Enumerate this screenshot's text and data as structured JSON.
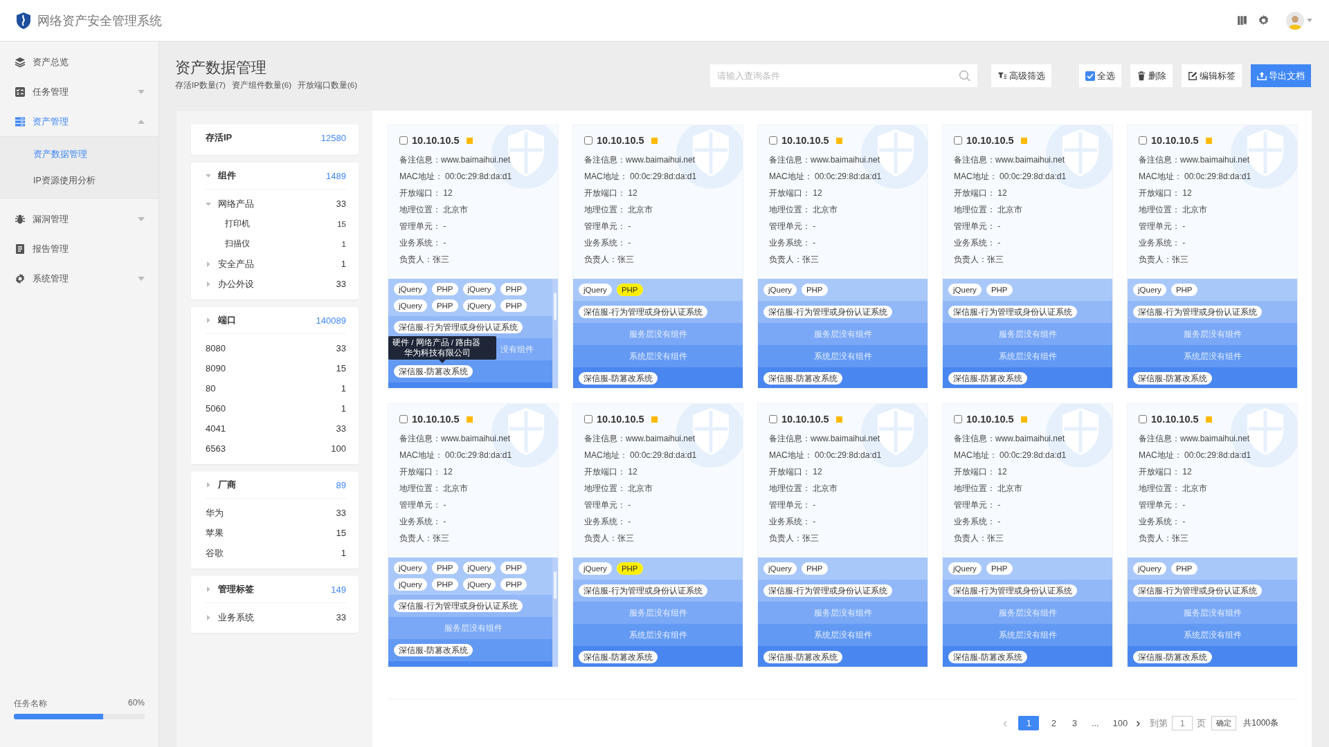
{
  "app": {
    "title": "网络资产安全管理系统"
  },
  "sidebar": {
    "items": [
      {
        "label": "资产总览",
        "selected": false
      },
      {
        "label": "任务管理",
        "selected": false,
        "expanded": false
      },
      {
        "label": "资产管理",
        "selected": true,
        "expanded": true,
        "children": [
          {
            "label": "资产数据管理",
            "selected": true
          },
          {
            "label": "IP资源使用分析",
            "selected": false
          }
        ]
      },
      {
        "label": "漏洞管理",
        "selected": false,
        "expanded": false
      },
      {
        "label": "报告管理",
        "selected": false
      },
      {
        "label": "系统管理",
        "selected": false,
        "expanded": false
      }
    ],
    "task": {
      "label": "任务名称",
      "reading": "60%",
      "level": 0.68
    }
  },
  "header": {
    "title": "资产数据管理",
    "stats": [
      "存活IP数量(7)",
      "资产组件数量(6)",
      "开放端口数量(6)"
    ]
  },
  "toolbar": {
    "search": {
      "placeholder": "请输入查询条件"
    },
    "buttons": [
      {
        "kind": "filter",
        "label": "高级筛选"
      },
      {
        "kind": "select_all",
        "label": "全选",
        "checked": true
      },
      {
        "kind": "delete",
        "label": "删除"
      },
      {
        "kind": "edit",
        "label": "编辑标签"
      },
      {
        "kind": "export",
        "label": "导出文档"
      }
    ]
  },
  "filters": [
    {
      "label": "存活IP",
      "count": "12580"
    },
    {
      "label": "组件",
      "count": "1489",
      "expanded": true,
      "children": [
        {
          "label": "网络产品",
          "count": "33",
          "expanded": true,
          "children": [
            {
              "label": "打印机",
              "count": "15"
            },
            {
              "label": "扫描仪",
              "count": "1"
            }
          ]
        },
        {
          "label": "安全产品",
          "count": "1",
          "expanded": false
        },
        {
          "label": "办公外设",
          "count": "33",
          "expanded": false
        }
      ]
    },
    {
      "label": "端口",
      "count": "140089",
      "expanded": false,
      "items": [
        {
          "label": "8080",
          "count": "33"
        },
        {
          "label": "8090",
          "count": "15"
        },
        {
          "label": "80",
          "count": "1"
        },
        {
          "label": "5060",
          "count": "1"
        },
        {
          "label": "4041",
          "count": "33"
        },
        {
          "label": "6563",
          "count": "100"
        }
      ]
    },
    {
      "label": "厂商",
      "count": "89",
      "expanded": false,
      "items": [
        {
          "label": "华为",
          "count": "33"
        },
        {
          "label": "苹果",
          "count": "15"
        },
        {
          "label": "谷歌",
          "count": "1"
        }
      ]
    },
    {
      "label": "管理标签",
      "count": "149",
      "expanded": false,
      "children": [
        {
          "label": "业务系统",
          "count": "33",
          "expanded": false
        }
      ]
    }
  ],
  "cards": [
    {
      "ip": "10.10.10.5",
      "checked": false,
      "color": "#ffb900",
      "info": [
        "备注信息：www.baimaihui.net",
        "MAC地址： 00:0c:29:8d:da:d1",
        "开放端口： 12",
        "地理位置： 北京市",
        "管理单元： -",
        "业务系统： -",
        "负责人：张三"
      ],
      "scrollable": true,
      "bands": [
        {
          "kind": "tags",
          "tags": [
            {
              "text": "jQuery",
              "highlighted": false
            },
            {
              "text": "PHP",
              "highlighted": false
            },
            {
              "text": "jQuery",
              "highlighted": false
            },
            {
              "text": "PHP",
              "highlighted": false
            },
            {
              "text": "jQuery",
              "highlighted": false
            },
            {
              "text": "PHP",
              "highlighted": false
            },
            {
              "text": "jQuery",
              "highlighted": false
            },
            {
              "text": "PHP",
              "highlighted": false
            }
          ]
        },
        {
          "kind": "tag",
          "text": "深信服-行为管理或身份认证系统"
        },
        {
          "kind": "note",
          "text": "没有组件",
          "tooltip": {
            "lines": [
              "硬件 / 网络产品 / 路由器",
              "华为科技有限公司"
            ]
          }
        },
        {
          "kind": "tag",
          "text": "深信服-防篡改系统"
        }
      ]
    },
    {
      "ip": "10.10.10.5",
      "checked": false,
      "color": "#ffb900",
      "info": [
        "备注信息：www.baimaihui.net",
        "MAC地址： 00:0c:29:8d:da:d1",
        "开放端口： 12",
        "地理位置： 北京市",
        "管理单元： -",
        "业务系统： -",
        "负责人：张三"
      ],
      "scrollable": false,
      "bands": [
        {
          "kind": "tags",
          "tags": [
            {
              "text": "jQuery",
              "highlighted": false
            },
            {
              "text": "PHP",
              "highlighted": true
            }
          ]
        },
        {
          "kind": "tag",
          "text": "深信服-行为管理或身份认证系统"
        },
        {
          "kind": "note",
          "text": "服务层没有组件"
        },
        {
          "kind": "note",
          "text": "系统层没有组件"
        },
        {
          "kind": "tag",
          "text": "深信服-防篡改系统"
        }
      ]
    },
    {
      "ip": "10.10.10.5",
      "checked": false,
      "color": "#ffb900",
      "info": [
        "备注信息：www.baimaihui.net",
        "MAC地址： 00:0c:29:8d:da:d1",
        "开放端口： 12",
        "地理位置： 北京市",
        "管理单元： -",
        "业务系统： -",
        "负责人：张三"
      ],
      "scrollable": false,
      "bands": [
        {
          "kind": "tags",
          "tags": [
            {
              "text": "jQuery",
              "highlighted": false
            },
            {
              "text": "PHP",
              "highlighted": false
            }
          ]
        },
        {
          "kind": "tag",
          "text": "深信服-行为管理或身份认证系统"
        },
        {
          "kind": "note",
          "text": "服务层没有组件"
        },
        {
          "kind": "note",
          "text": "系统层没有组件"
        },
        {
          "kind": "tag",
          "text": "深信服-防篡改系统"
        }
      ]
    },
    {
      "ip": "10.10.10.5",
      "checked": false,
      "color": "#ffb900",
      "info": [
        "备注信息：www.baimaihui.net",
        "MAC地址： 00:0c:29:8d:da:d1",
        "开放端口： 12",
        "地理位置： 北京市",
        "管理单元： -",
        "业务系统： -",
        "负责人：张三"
      ],
      "scrollable": false,
      "bands": [
        {
          "kind": "tags",
          "tags": [
            {
              "text": "jQuery",
              "highlighted": false
            },
            {
              "text": "PHP",
              "highlighted": false
            }
          ]
        },
        {
          "kind": "tag",
          "text": "深信服-行为管理或身份认证系统"
        },
        {
          "kind": "note",
          "text": "服务层没有组件"
        },
        {
          "kind": "note",
          "text": "系统层没有组件"
        },
        {
          "kind": "tag",
          "text": "深信服-防篡改系统"
        }
      ]
    },
    {
      "ip": "10.10.10.5",
      "checked": false,
      "color": "#ffb900",
      "info": [
        "备注信息：www.baimaihui.net",
        "MAC地址： 00:0c:29:8d:da:d1",
        "开放端口： 12",
        "地理位置： 北京市",
        "管理单元： -",
        "业务系统： -",
        "负责人：张三"
      ],
      "scrollable": false,
      "bands": [
        {
          "kind": "tags",
          "tags": [
            {
              "text": "jQuery",
              "highlighted": false
            },
            {
              "text": "PHP",
              "highlighted": false
            }
          ]
        },
        {
          "kind": "tag",
          "text": "深信服-行为管理或身份认证系统"
        },
        {
          "kind": "note",
          "text": "服务层没有组件"
        },
        {
          "kind": "note",
          "text": "系统层没有组件"
        },
        {
          "kind": "tag",
          "text": "深信服-防篡改系统"
        }
      ]
    },
    {
      "ip": "10.10.10.5",
      "checked": false,
      "color": "#ffb900",
      "info": [
        "备注信息：www.baimaihui.net",
        "MAC地址： 00:0c:29:8d:da:d1",
        "开放端口： 12",
        "地理位置： 北京市",
        "管理单元： -",
        "业务系统： -",
        "负责人：张三"
      ],
      "scrollable": true,
      "bands": [
        {
          "kind": "tags",
          "tags": [
            {
              "text": "jQuery",
              "highlighted": false
            },
            {
              "text": "PHP",
              "highlighted": false
            },
            {
              "text": "jQuery",
              "highlighted": false
            },
            {
              "text": "PHP",
              "highlighted": false
            },
            {
              "text": "jQuery",
              "highlighted": false
            },
            {
              "text": "PHP",
              "highlighted": false
            },
            {
              "text": "jQuery",
              "highlighted": false
            },
            {
              "text": "PHP",
              "highlighted": false
            }
          ]
        },
        {
          "kind": "tag",
          "text": "深信服-行为管理或身份认证系统"
        },
        {
          "kind": "note",
          "text": "服务层没有组件"
        },
        {
          "kind": "tag",
          "text": "深信服-防篡改系统"
        }
      ]
    },
    {
      "ip": "10.10.10.5",
      "checked": false,
      "color": "#ffb900",
      "info": [
        "备注信息：www.baimaihui.net",
        "MAC地址： 00:0c:29:8d:da:d1",
        "开放端口： 12",
        "地理位置： 北京市",
        "管理单元： -",
        "业务系统： -",
        "负责人：张三"
      ],
      "scrollable": false,
      "bands": [
        {
          "kind": "tags",
          "tags": [
            {
              "text": "jQuery",
              "highlighted": false
            },
            {
              "text": "PHP",
              "highlighted": true
            }
          ]
        },
        {
          "kind": "tag",
          "text": "深信服-行为管理或身份认证系统"
        },
        {
          "kind": "note",
          "text": "服务层没有组件"
        },
        {
          "kind": "note",
          "text": "系统层没有组件"
        },
        {
          "kind": "tag",
          "text": "深信服-防篡改系统"
        }
      ]
    },
    {
      "ip": "10.10.10.5",
      "checked": false,
      "color": "#ffb900",
      "info": [
        "备注信息：www.baimaihui.net",
        "MAC地址： 00:0c:29:8d:da:d1",
        "开放端口： 12",
        "地理位置： 北京市",
        "管理单元： -",
        "业务系统： -",
        "负责人：张三"
      ],
      "scrollable": false,
      "bands": [
        {
          "kind": "tags",
          "tags": [
            {
              "text": "jQuery",
              "highlighted": false
            },
            {
              "text": "PHP",
              "highlighted": false
            }
          ]
        },
        {
          "kind": "tag",
          "text": "深信服-行为管理或身份认证系统"
        },
        {
          "kind": "note",
          "text": "服务层没有组件"
        },
        {
          "kind": "note",
          "text": "系统层没有组件"
        },
        {
          "kind": "tag",
          "text": "深信服-防篡改系统"
        }
      ]
    },
    {
      "ip": "10.10.10.5",
      "checked": false,
      "color": "#ffb900",
      "info": [
        "备注信息：www.baimaihui.net",
        "MAC地址： 00:0c:29:8d:da:d1",
        "开放端口： 12",
        "地理位置： 北京市",
        "管理单元： -",
        "业务系统： -",
        "负责人：张三"
      ],
      "scrollable": false,
      "bands": [
        {
          "kind": "tags",
          "tags": [
            {
              "text": "jQuery",
              "highlighted": false
            },
            {
              "text": "PHP",
              "highlighted": false
            }
          ]
        },
        {
          "kind": "tag",
          "text": "深信服-行为管理或身份认证系统"
        },
        {
          "kind": "note",
          "text": "服务层没有组件"
        },
        {
          "kind": "note",
          "text": "系统层没有组件"
        },
        {
          "kind": "tag",
          "text": "深信服-防篡改系统"
        }
      ]
    },
    {
      "ip": "10.10.10.5",
      "checked": false,
      "color": "#ffb900",
      "info": [
        "备注信息：www.baimaihui.net",
        "MAC地址： 00:0c:29:8d:da:d1",
        "开放端口： 12",
        "地理位置： 北京市",
        "管理单元： -",
        "业务系统： -",
        "负责人：张三"
      ],
      "scrollable": false,
      "bands": [
        {
          "kind": "tags",
          "tags": [
            {
              "text": "jQuery",
              "highlighted": false
            },
            {
              "text": "PHP",
              "highlighted": false
            }
          ]
        },
        {
          "kind": "tag",
          "text": "深信服-行为管理或身份认证系统"
        },
        {
          "kind": "note",
          "text": "服务层没有组件"
        },
        {
          "kind": "note",
          "text": "系统层没有组件"
        },
        {
          "kind": "tag",
          "text": "深信服-防篡改系统"
        }
      ]
    }
  ],
  "pagination": {
    "prev": {
      "text": "‹",
      "disabled": true
    },
    "pages": [
      {
        "text": "1",
        "selected": true
      },
      {
        "text": "2",
        "selected": false
      },
      {
        "text": "3",
        "selected": false
      },
      {
        "text": "...",
        "kind": "ellipsis"
      },
      {
        "text": "100",
        "selected": false
      }
    ],
    "next": {
      "text": "›",
      "disabled": false
    },
    "goto_label": "到第",
    "goto_value": "1",
    "goto_suffix": "页",
    "confirm": "确定",
    "total": "共1000条"
  }
}
